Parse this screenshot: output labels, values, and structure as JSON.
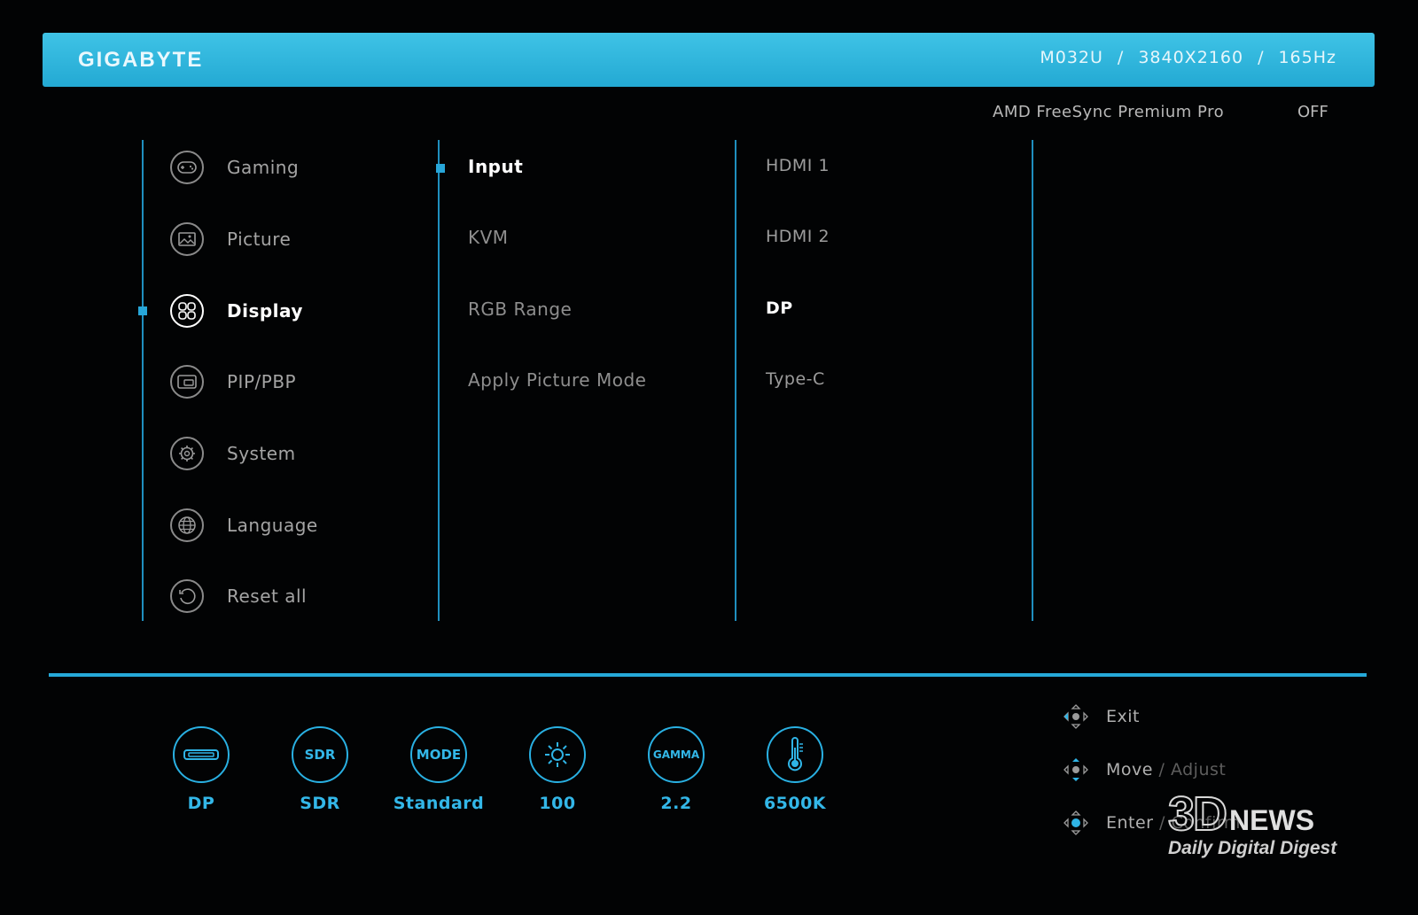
{
  "header": {
    "brand": "GIGABYTE",
    "model": "M032U",
    "resolution": "3840X2160",
    "refresh": "165Hz",
    "accent_color": "#29afe0"
  },
  "freesync": {
    "label": "AMD FreeSync Premium Pro",
    "value": "OFF"
  },
  "main_menu": [
    {
      "label": "Gaming",
      "icon": "gamepad-icon"
    },
    {
      "label": "Picture",
      "icon": "picture-icon"
    },
    {
      "label": "Display",
      "icon": "display-grid-icon",
      "active": true
    },
    {
      "label": "PIP/PBP",
      "icon": "pip-icon"
    },
    {
      "label": "System",
      "icon": "gear-icon"
    },
    {
      "label": "Language",
      "icon": "globe-icon"
    },
    {
      "label": "Reset all",
      "icon": "reset-icon"
    }
  ],
  "sub_menu": [
    {
      "label": "Input",
      "active": true
    },
    {
      "label": "KVM"
    },
    {
      "label": "RGB Range"
    },
    {
      "label": "Apply Picture Mode"
    }
  ],
  "options": [
    {
      "label": "HDMI 1"
    },
    {
      "label": "HDMI 2"
    },
    {
      "label": "DP",
      "active": true
    },
    {
      "label": "Type-C"
    }
  ],
  "status_bar": [
    {
      "icon": "port-icon",
      "badge": "",
      "value": "DP"
    },
    {
      "icon": "sdr-icon",
      "badge": "SDR",
      "value": "SDR"
    },
    {
      "icon": "mode-icon",
      "badge": "MODE",
      "value": "Standard"
    },
    {
      "icon": "brightness-icon",
      "badge": "",
      "value": "100"
    },
    {
      "icon": "gamma-icon",
      "badge": "GAMMA",
      "value": "2.2"
    },
    {
      "icon": "thermometer-icon",
      "badge": "",
      "value": "6500K"
    }
  ],
  "nav_hints": [
    {
      "label": "Exit",
      "icon": "joystick-left-icon"
    },
    {
      "label": "Move",
      "label_secondary": "/ Adjust",
      "icon": "joystick-updown-icon"
    },
    {
      "label": "Enter",
      "label_secondary": "/ Confirm",
      "icon": "joystick-press-icon"
    }
  ],
  "watermark": {
    "big": "3D",
    "news": "NEWS",
    "sub": "Daily Digital Digest"
  }
}
